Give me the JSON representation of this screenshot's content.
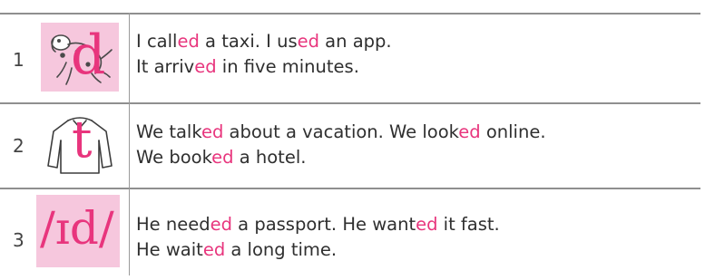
{
  "rows": [
    {
      "number": "1",
      "sound": "d",
      "picture": "dog-icon",
      "lines": [
        [
          {
            "t": "I call"
          },
          {
            "t": "ed",
            "hl": true
          },
          {
            "t": " a taxi. I us"
          },
          {
            "t": "ed",
            "hl": true
          },
          {
            "t": " an app."
          }
        ],
        [
          {
            "t": "It arriv"
          },
          {
            "t": "ed",
            "hl": true
          },
          {
            "t": " in five minutes."
          }
        ]
      ]
    },
    {
      "number": "2",
      "sound": "t",
      "picture": "shirt-icon",
      "lines": [
        [
          {
            "t": "We talk"
          },
          {
            "t": "ed",
            "hl": true
          },
          {
            "t": " about a vacation. We look"
          },
          {
            "t": "ed",
            "hl": true
          },
          {
            "t": " online."
          }
        ],
        [
          {
            "t": "We book"
          },
          {
            "t": "ed",
            "hl": true
          },
          {
            "t": " a hotel."
          }
        ]
      ]
    },
    {
      "number": "3",
      "sound": "/ɪd/",
      "picture": "none",
      "lines": [
        [
          {
            "t": "He need"
          },
          {
            "t": "ed",
            "hl": true
          },
          {
            "t": " a passport. He want"
          },
          {
            "t": "ed",
            "hl": true
          },
          {
            "t": " it fast."
          }
        ],
        [
          {
            "t": "He wait"
          },
          {
            "t": "ed",
            "hl": true
          },
          {
            "t": " a long time."
          }
        ]
      ]
    }
  ],
  "colors": {
    "accent": "#e8357d",
    "tile": "#f6c7dd",
    "rule": "#8f8f8f"
  }
}
